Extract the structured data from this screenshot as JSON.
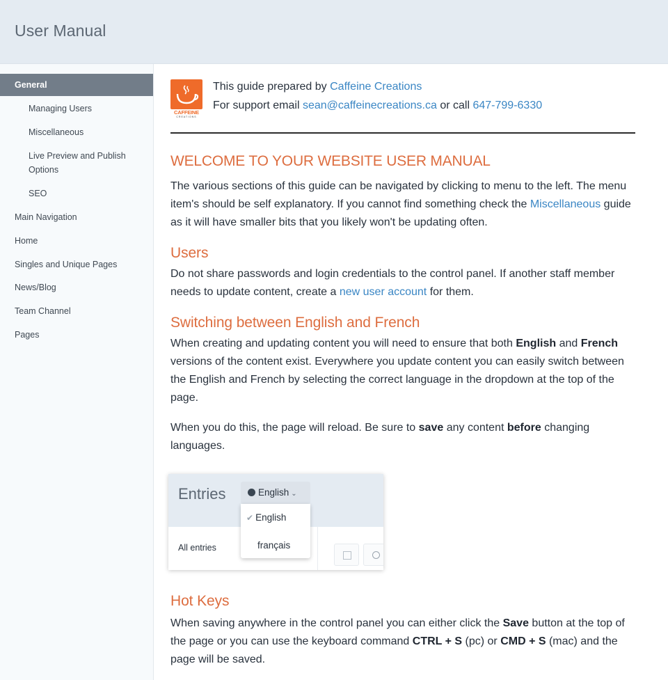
{
  "header": {
    "title": "User Manual"
  },
  "sidebar": {
    "items": [
      {
        "label": "General",
        "level": "top",
        "active": true
      },
      {
        "label": "Managing Users",
        "level": "sub"
      },
      {
        "label": "Miscellaneous",
        "level": "sub"
      },
      {
        "label": "Live Preview and Publish Options",
        "level": "sub"
      },
      {
        "label": "SEO",
        "level": "sub"
      },
      {
        "label": "Main Navigation",
        "level": "top"
      },
      {
        "label": "Home",
        "level": "top"
      },
      {
        "label": "Singles and Unique Pages",
        "level": "top"
      },
      {
        "label": "News/Blog",
        "level": "top"
      },
      {
        "label": "Team Channel",
        "level": "top"
      },
      {
        "label": "Pages",
        "level": "top"
      }
    ]
  },
  "credit": {
    "logo_brand": "CAFFEINE",
    "logo_sub": "CREATIONS",
    "line1_prefix": "This guide prepared by ",
    "company_link": "Caffeine Creations",
    "line2_prefix": "For support email ",
    "email_link": "sean@caffeinecreations.ca",
    "line2_middle": " or call ",
    "phone_link": "647-799-6330"
  },
  "welcome": {
    "heading": "WELCOME TO YOUR WEBSITE USER MANUAL",
    "text_before": "The various sections of this guide can be navigated by clicking to menu to the left. The menu item's should be self explanatory. If you cannot find something check the ",
    "link": "Miscellaneous",
    "text_after": " guide as it will have smaller bits that you likely won't be updating often."
  },
  "users": {
    "heading": "Users",
    "text_before": "Do not share passwords and login credentials to the control panel. If another staff member needs to update content, create a ",
    "link": "new user account",
    "text_after": " for them."
  },
  "switching": {
    "heading": "Switching between English and French",
    "p1_a": "When creating and updating content you will need to ensure that both ",
    "p1_b1": "English",
    "p1_c": " and ",
    "p1_b2": "French",
    "p1_d": " versions of the content exist. Everywhere you update content you can easily switch between the English and French by selecting the correct language in the dropdown at the top of the page.",
    "p2_a": "When you do this, the page will reload. Be sure to ",
    "p2_b1": "save",
    "p2_c": " any content ",
    "p2_b2": "before",
    "p2_d": " changing languages."
  },
  "figure": {
    "title": "Entries",
    "selected_language": "English",
    "options": [
      "English",
      "français"
    ],
    "row_label": "All entries"
  },
  "hotkeys": {
    "heading": "Hot Keys",
    "a": "When saving anywhere in the control panel you can either click the ",
    "b1": "Save",
    "c": " button at the top of the page or you can use the keyboard command ",
    "b2": "CTRL + S",
    "d": " (pc) or ",
    "b3": "CMD + S",
    "e": " (mac) and the page will be saved."
  },
  "colors": {
    "accent_heading": "#dd6d3f",
    "link": "#3a86c4",
    "brand_orange": "#ef6b2a",
    "sidebar_active": "#727d89",
    "header_bg": "#e4ebf2"
  }
}
